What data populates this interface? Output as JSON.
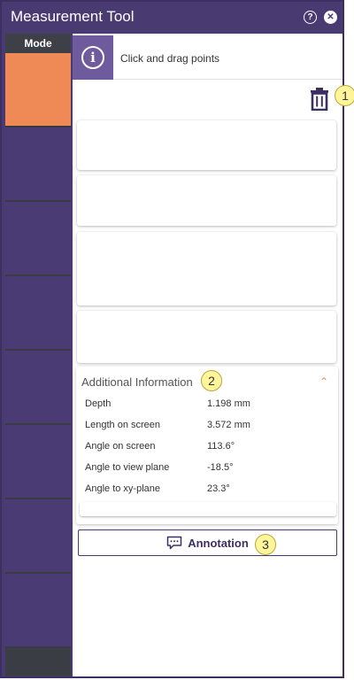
{
  "window": {
    "title": "Measurement Tool",
    "help_icon": "question-circle-icon",
    "close_icon": "close-circle-icon",
    "accent_color": "#4a3a72",
    "active_color": "#ef8a56"
  },
  "sidebar": {
    "mode_label": "Mode",
    "items": [
      {
        "active": true
      },
      {
        "active": false
      },
      {
        "active": false
      },
      {
        "active": false
      },
      {
        "active": false
      },
      {
        "active": false
      },
      {
        "active": false
      },
      {
        "active": false
      }
    ]
  },
  "banner": {
    "icon": "info-icon",
    "text": "Click and drag points"
  },
  "callouts": [
    "1",
    "2",
    "3"
  ],
  "additional_info": {
    "title": "Additional Information",
    "rows": [
      {
        "label": "Depth",
        "value": "1.198 mm"
      },
      {
        "label": "Length on screen",
        "value": "3.572 mm"
      },
      {
        "label": "Angle on screen",
        "value": "113.6°"
      },
      {
        "label": "Angle to view plane",
        "value": "-18.5°"
      },
      {
        "label": "Angle to xy-plane",
        "value": "23.3°"
      }
    ]
  },
  "annotation_button": {
    "label": "Annotation",
    "icon": "comment-icon"
  }
}
